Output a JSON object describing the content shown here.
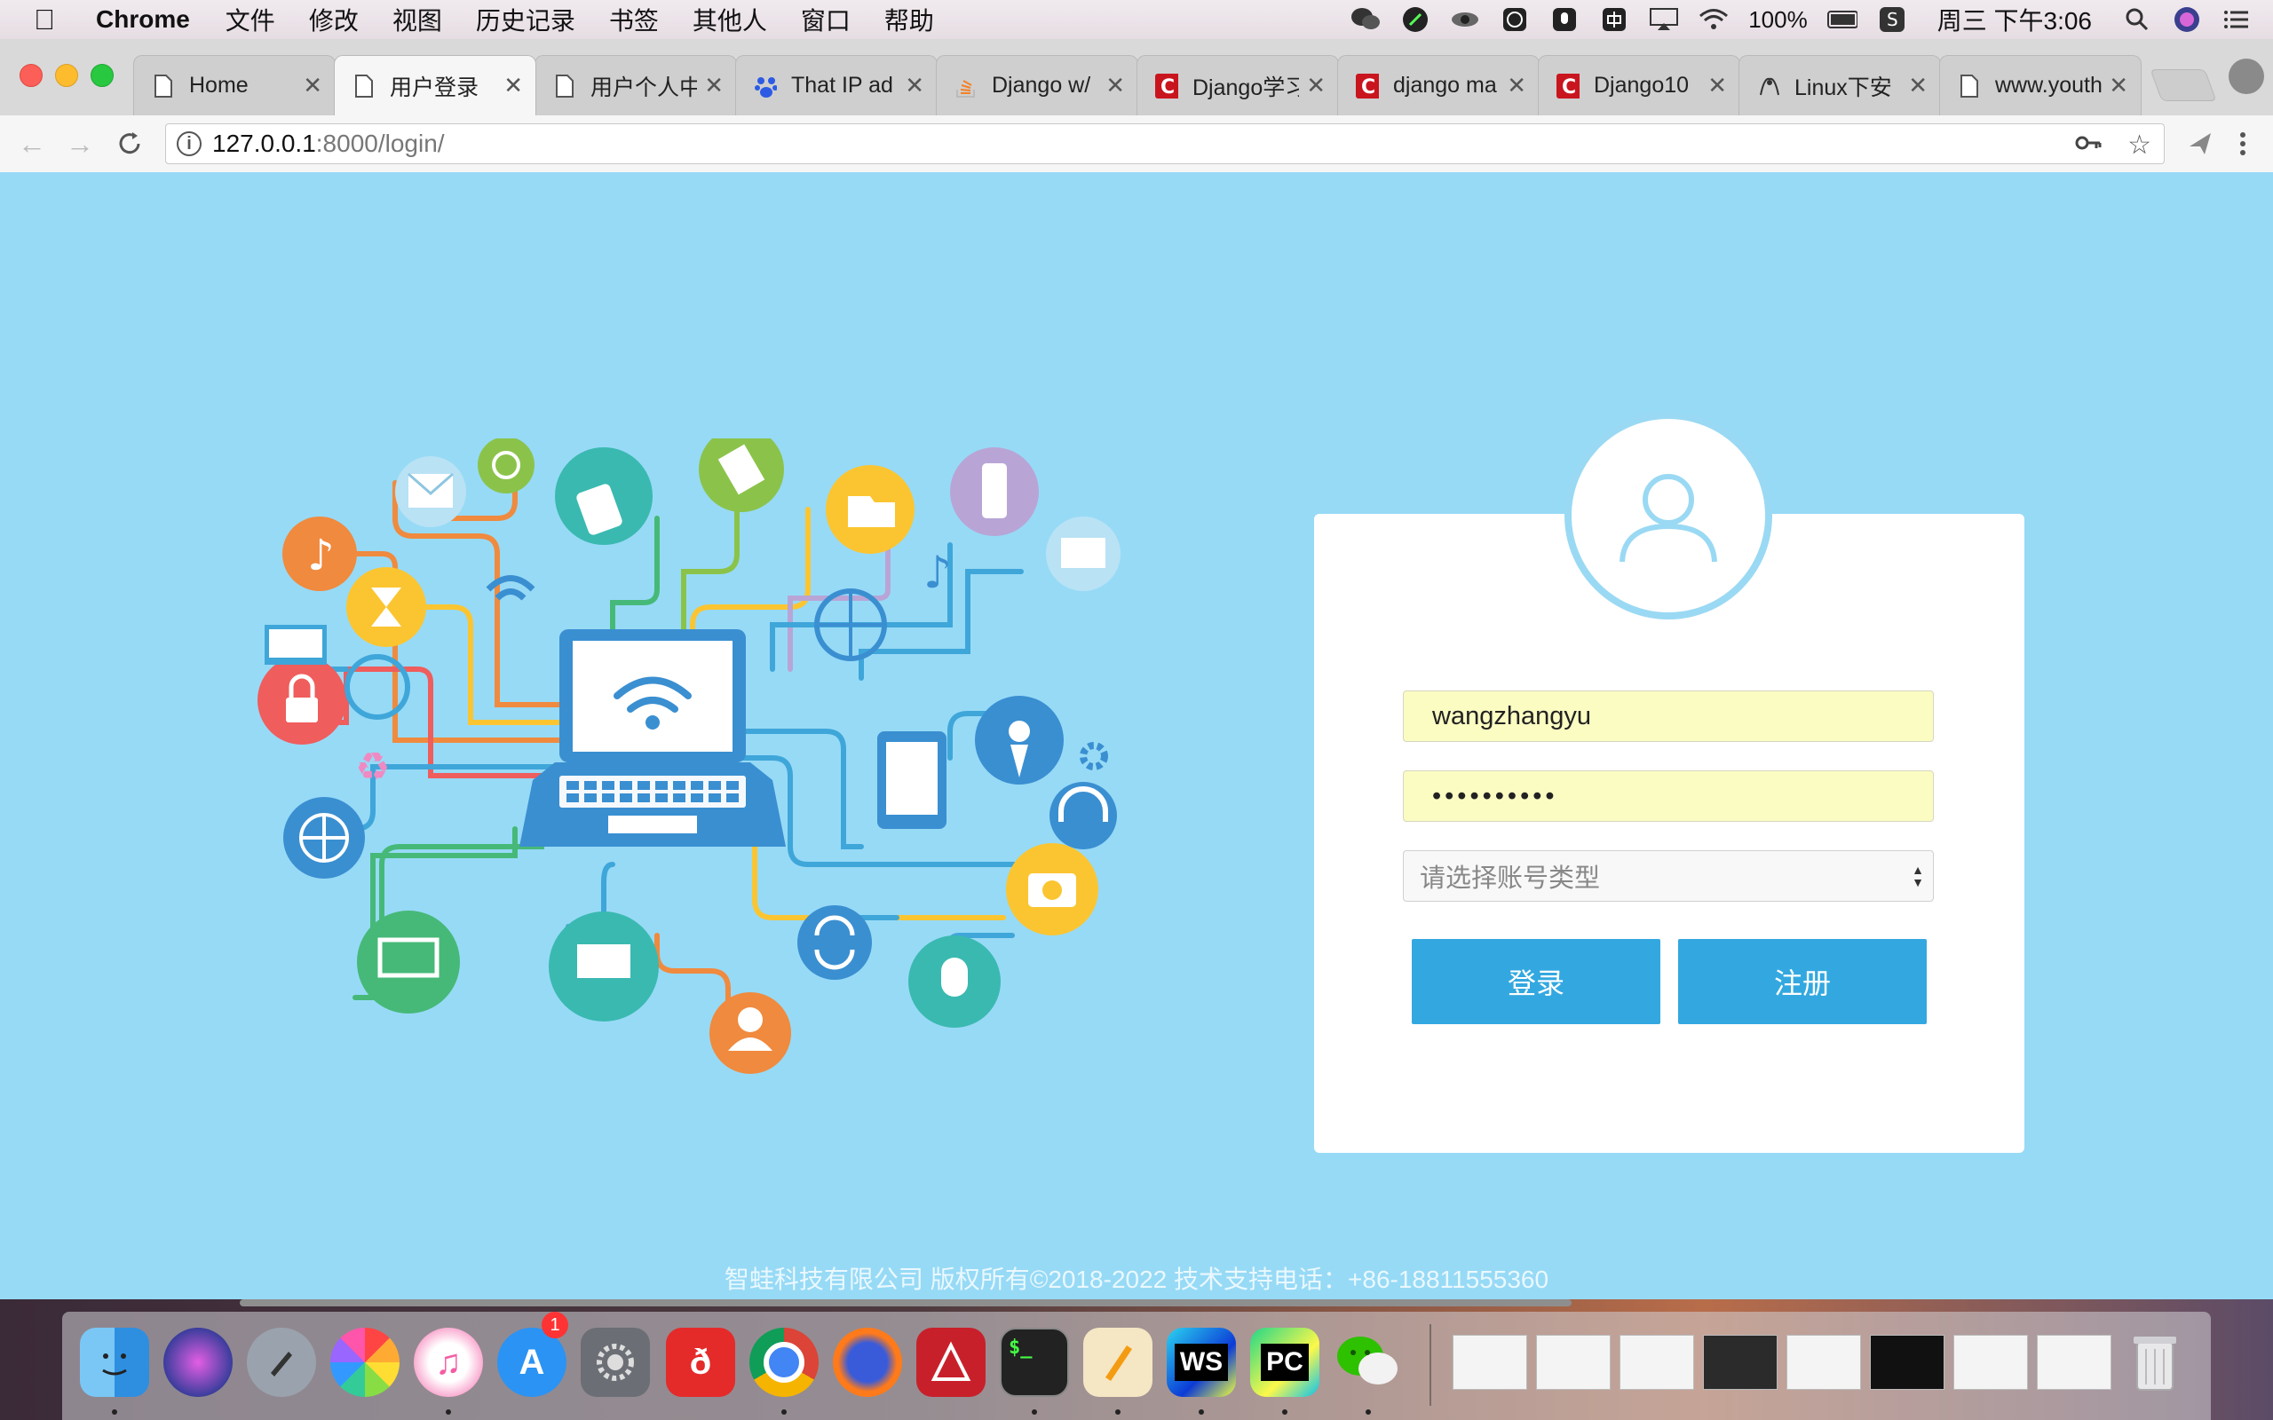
{
  "menubar": {
    "app_name": "Chrome",
    "items": [
      "文件",
      "修改",
      "视图",
      "历史记录",
      "书签",
      "其他人",
      "窗口",
      "帮助"
    ],
    "battery": "100%",
    "clock": "周三 下午3:06",
    "status_icons": [
      "wechat-icon",
      "stylus-icon",
      "eye-icon",
      "smiley-icon",
      "mic-icon",
      "input-method-icon",
      "airplay-icon",
      "wifi-icon",
      "battery-icon",
      "s-icon",
      "search-icon",
      "siri-icon",
      "notification-list-icon"
    ]
  },
  "tabs": [
    {
      "label": "Home",
      "icon": "page-icon"
    },
    {
      "label": "用户登录",
      "icon": "page-icon",
      "active": true
    },
    {
      "label": "用户个人中",
      "icon": "page-icon"
    },
    {
      "label": "That IP ad",
      "icon": "baidu-icon"
    },
    {
      "label": "Django w/",
      "icon": "stackoverflow-icon"
    },
    {
      "label": "Django学习",
      "icon": "csdn-icon"
    },
    {
      "label": "django ma",
      "icon": "csdn-icon"
    },
    {
      "label": "Django10",
      "icon": "csdn-icon"
    },
    {
      "label": "Linux下安",
      "icon": "linux-icon"
    },
    {
      "label": "www.youth",
      "icon": "page-icon"
    }
  ],
  "address_bar": {
    "host": "127.0.0.1",
    "rest": ":8000/login/"
  },
  "login_form": {
    "username_value": "wangzhangyu",
    "password_value": "••••••••••",
    "account_type_placeholder": "请选择账号类型",
    "login_label": "登录",
    "register_label": "注册"
  },
  "footer": {
    "text": "智蛙科技有限公司 版权所有©2018-2022 技术支持电话：+86-18811555360"
  },
  "dock": {
    "apps": [
      "finder-icon",
      "siri-icon",
      "launchpad-icon",
      "photos-icon",
      "itunes-icon",
      "app-store-icon",
      "system-preferences-icon",
      "netease-music-icon",
      "chrome-icon",
      "firefox-icon",
      "autocad-icon",
      "terminal-icon",
      "pages-icon",
      "webstorm-icon",
      "pycharm-icon",
      "wechat-icon"
    ],
    "app_store_badge": "1",
    "terminal_label": "$_",
    "webstorm_label": "WS",
    "pycharm_label": "PC",
    "netease_label": "ð"
  },
  "colors": {
    "page_background": "#97daf6",
    "button": "#33a8e0",
    "autofill": "#fafcc2"
  }
}
